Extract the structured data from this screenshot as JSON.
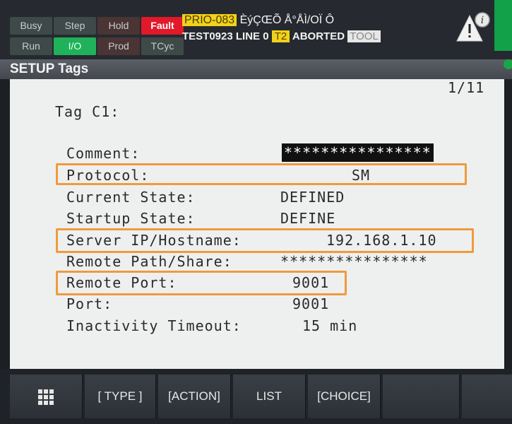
{
  "status": {
    "busy": "Busy",
    "step": "Step",
    "hold": "Hold",
    "fault": "Fault",
    "run": "Run",
    "io": "I/O",
    "prod": "Prod",
    "tcyc": "TCyc"
  },
  "message": {
    "prio_code": "PRIO-083",
    "line1_text": "ÈýÇŒÕ Å°ÅÌ/OÏ  Ô",
    "program": "TEST0923 LINE 0",
    "mode": "T2",
    "state": "ABORTED",
    "tool": "TOOL"
  },
  "screen": {
    "title": "SETUP Tags",
    "page": "1/11",
    "tag_label": "Tag C1:"
  },
  "fields": {
    "comment_label": "Comment:",
    "comment_value": "****************",
    "protocol_label": "Protocol:",
    "protocol_value": "SM",
    "current_state_label": "Current State:",
    "current_state_value": "DEFINED",
    "startup_state_label": "Startup State:",
    "startup_state_value": "DEFINE",
    "server_label": "Server IP/Hostname:",
    "server_value": "192.168.1.10",
    "remote_path_label": "Remote Path/Share:",
    "remote_path_value": "****************",
    "remote_port_label": "Remote Port:",
    "remote_port_value": "9001",
    "port_label": "Port:",
    "port_value": "9001",
    "timeout_label": "Inactivity Timeout:",
    "timeout_value": "15 min"
  },
  "softkeys": {
    "menu_icon": "grid-icon",
    "type": "[ TYPE ]",
    "action": "[ACTION]",
    "list": "LIST",
    "choice": "[CHOICE]"
  },
  "colors": {
    "fault": "#e2182b",
    "active": "#1fb25a",
    "highlight": "#ef9a3e",
    "prio": "#f2d21a"
  }
}
